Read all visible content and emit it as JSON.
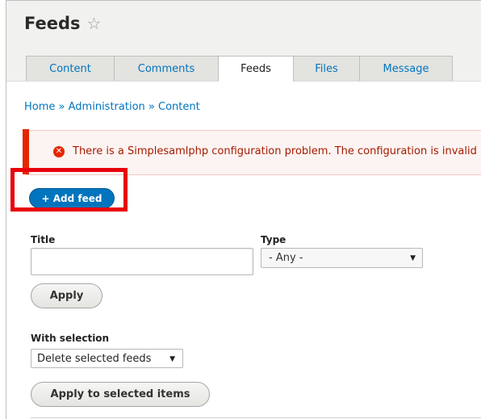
{
  "header": {
    "title": "Feeds",
    "star_icon": "☆",
    "tabs": [
      {
        "label": "Content",
        "active": false
      },
      {
        "label": "Comments",
        "active": false
      },
      {
        "label": "Feeds",
        "active": true
      },
      {
        "label": "Files",
        "active": false
      },
      {
        "label": "Message",
        "active": false
      }
    ]
  },
  "breadcrumb": {
    "items": [
      "Home",
      "Administration",
      "Content"
    ],
    "separator": "»"
  },
  "message": {
    "icon": "error-icon",
    "icon_glyph": "✕",
    "text": "There is a Simplesamlphp configuration problem. The configuration is invalid"
  },
  "actions": {
    "add_feed_label": "+ Add feed"
  },
  "filters": {
    "title_label": "Title",
    "title_value": "",
    "type_label": "Type",
    "type_value": "- Any -",
    "apply_label": "Apply"
  },
  "bulk": {
    "label": "With selection",
    "select_value": "Delete selected feeds",
    "apply_label": "Apply to selected items"
  },
  "colors": {
    "accent": "#0074bd",
    "error": "#e62600",
    "highlight": "#e8000b"
  }
}
